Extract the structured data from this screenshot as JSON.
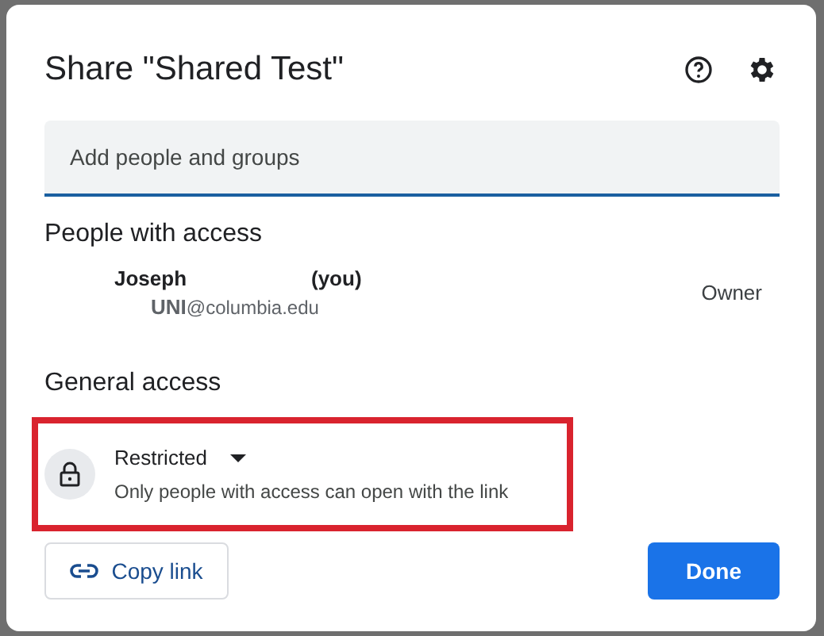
{
  "dialog": {
    "title": "Share \"Shared Test\""
  },
  "add_field": {
    "placeholder": "Add people and groups"
  },
  "people_section": {
    "heading": "People with access",
    "people": [
      {
        "name": "Joseph",
        "suffix": "(you)",
        "id_prefix": "UNI",
        "email": "@columbia.edu",
        "role": "Owner"
      }
    ]
  },
  "general_access": {
    "heading": "General access",
    "option": "Restricted",
    "description": "Only people with access can open with the link",
    "highlighted": true
  },
  "buttons": {
    "copy_link": "Copy link",
    "done": "Done"
  }
}
